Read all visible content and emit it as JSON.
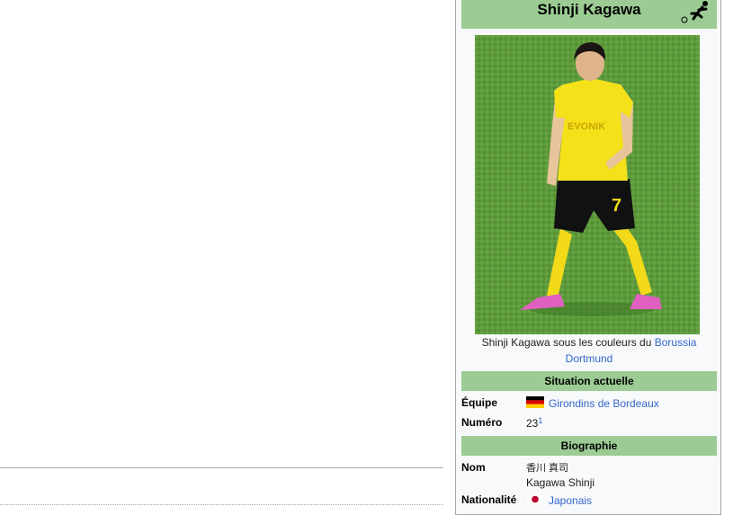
{
  "infobox": {
    "title": "Shinji Kagawa",
    "caption_text": "Shinji Kagawa sous les couleurs du ",
    "caption_link": "Borussia Dortmund",
    "sections": {
      "current": {
        "heading": "Situation actuelle",
        "team_label": "Équipe",
        "team_value": "Girondins de Bordeaux",
        "number_label": "Numéro",
        "number_value": "23",
        "number_ref": "1"
      },
      "bio": {
        "heading": "Biographie",
        "name_label": "Nom",
        "name_native": "香川 真司",
        "name_romanized": "Kagawa Shinji",
        "nationality_label": "Nationalité",
        "nationality_value": "Japonais"
      }
    },
    "icons": {
      "title_icon": "football-player-icon",
      "germany_flag": "germany-flag-icon",
      "japan_flag": "japan-flag-icon"
    },
    "colors": {
      "header_bg": "#9ccc94",
      "link": "#3366cc",
      "jersey": "#f5e11a",
      "pitch": "#5d9b3b"
    }
  }
}
